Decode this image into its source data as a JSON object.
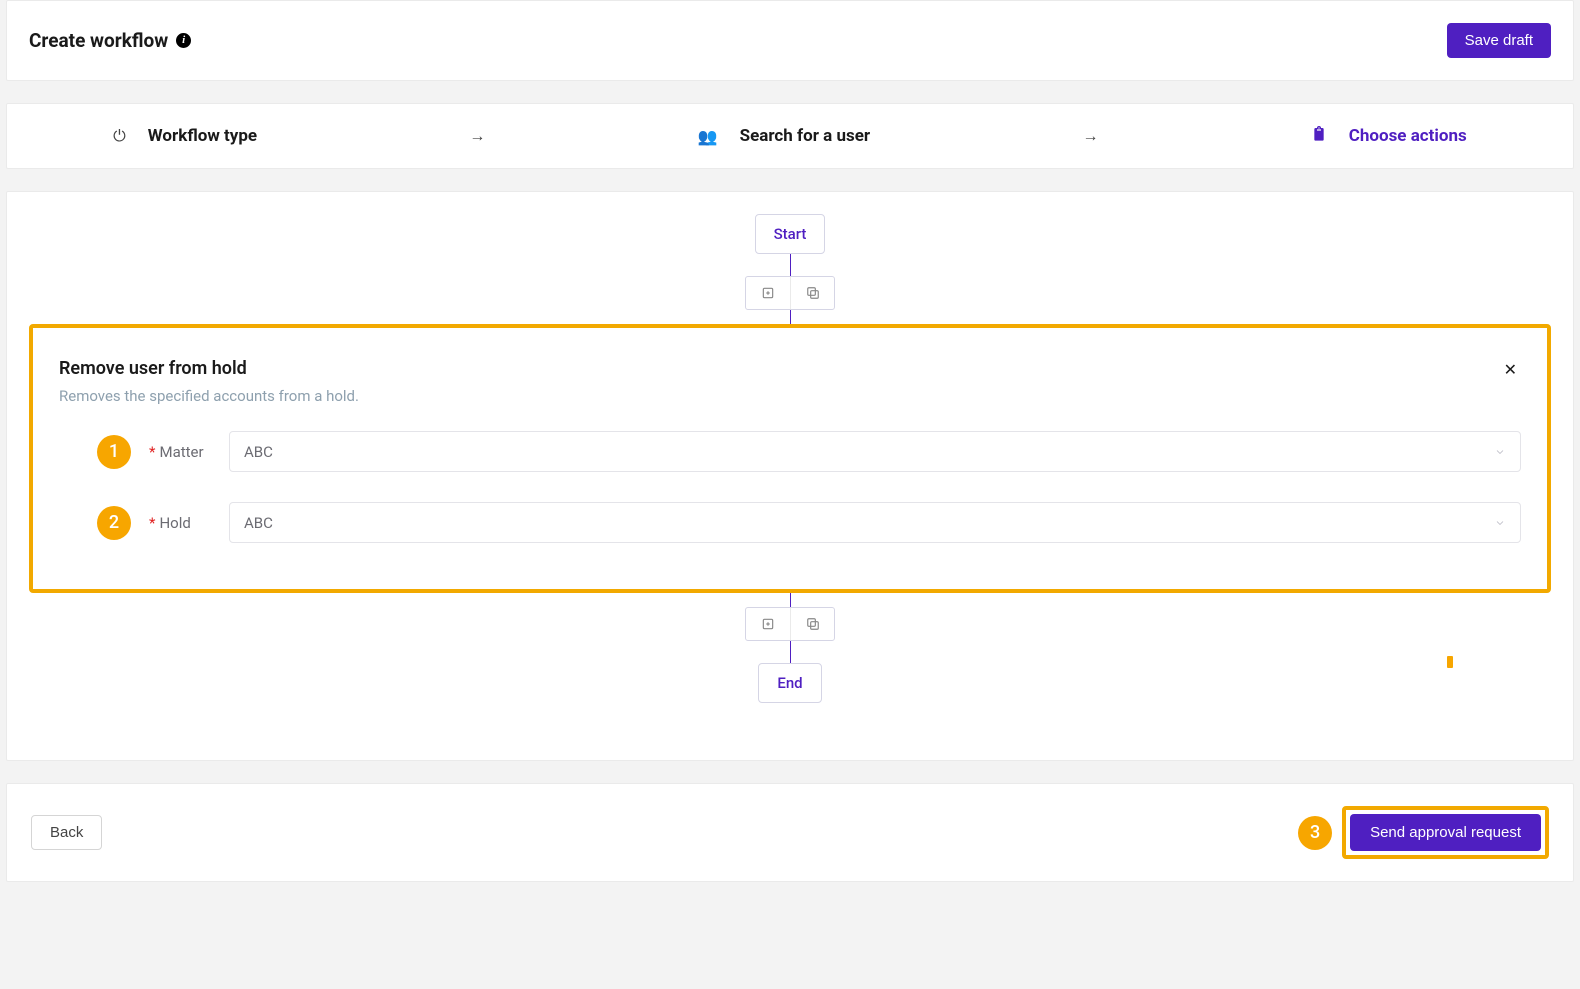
{
  "header": {
    "title": "Create workflow",
    "save_label": "Save draft"
  },
  "steps": {
    "workflow_type": "Workflow type",
    "search_user": "Search for a user",
    "choose_actions": "Choose actions"
  },
  "flow": {
    "start": "Start",
    "end": "End"
  },
  "action": {
    "title": "Remove user from hold",
    "description": "Removes the specified accounts from a hold.",
    "fields": {
      "matter": {
        "label": "Matter",
        "value": "ABC",
        "required": "*",
        "badge": "1"
      },
      "hold": {
        "label": "Hold",
        "value": "ABC",
        "required": "*",
        "badge": "2"
      }
    }
  },
  "footer": {
    "back": "Back",
    "send": "Send approval request",
    "send_badge": "3"
  }
}
